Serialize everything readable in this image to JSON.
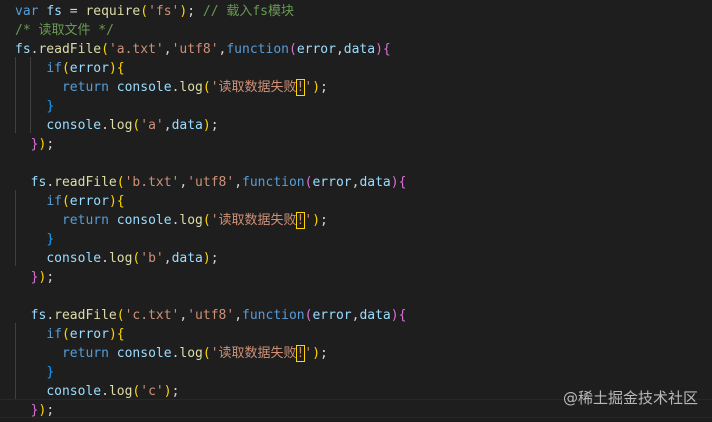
{
  "code_lines": [
    "var fs = require('fs'); // 载入fs模块",
    "/* 读取文件 */",
    "fs.readFile('a.txt','utf8',function(error,data){",
    "    if(error){",
    "      return console.log('读取数据失败!');",
    "    }",
    "    console.log('a',data);",
    "  });",
    "",
    "  fs.readFile('b.txt','utf8',function(error,data){",
    "    if(error){",
    "      return console.log('读取数据失败!');",
    "    }",
    "    console.log('b',data);",
    "  });",
    "",
    "  fs.readFile('c.txt','utf8',function(error,data){",
    "    if(error){",
    "      return console.log('读取数据失败!');",
    "    }",
    "    console.log('c');",
    "  });"
  ],
  "watermark": "@稀土掘金技术社区",
  "colors": {
    "background": "#1e1e1e",
    "keyword": "#569cd6",
    "identifier": "#9cdcfe",
    "function": "#dcdcaa",
    "string": "#ce9178",
    "comment": "#6a9955",
    "bracket_level1": "#ffd700",
    "bracket_level2": "#da70d6",
    "bracket_level3": "#179fff"
  }
}
